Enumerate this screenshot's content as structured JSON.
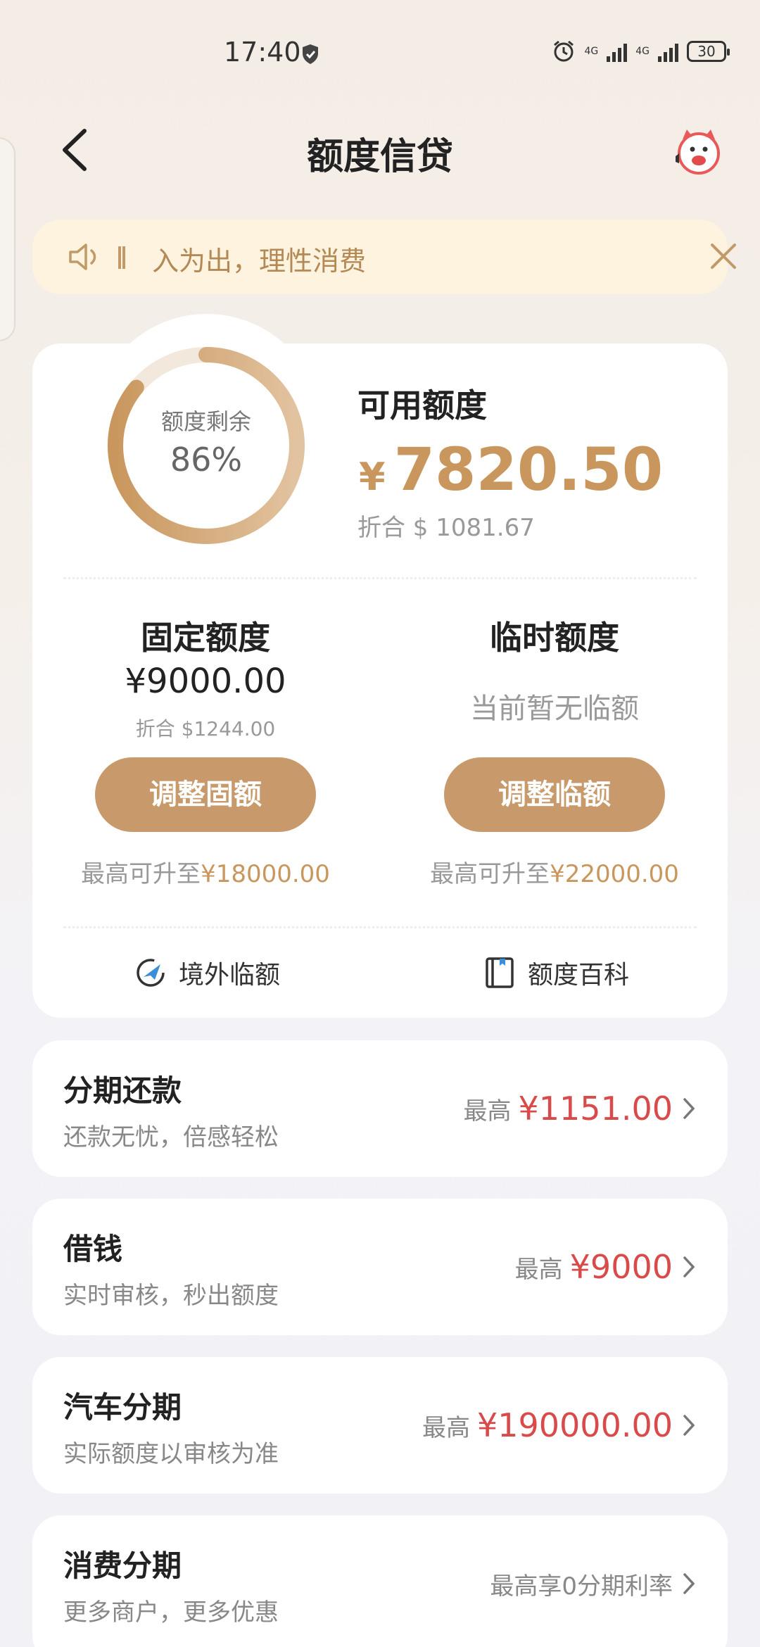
{
  "status_bar": {
    "time": "17:40",
    "signal1": "4G",
    "signal2": "4G",
    "battery": "30"
  },
  "header": {
    "title": "额度信贷"
  },
  "notice": {
    "text": "入为出，理性消费"
  },
  "quota": {
    "ring_label": "额度剩余",
    "ring_value": "86%",
    "ring_fraction": 0.86,
    "available_label": "可用额度",
    "currency_symbol": "¥",
    "available_amount": "7820.50",
    "available_usd": "折合 $ 1081.67",
    "fixed": {
      "title": "固定额度",
      "amount": "¥9000.00",
      "usd": "折合 $1244.00",
      "button": "调整固额",
      "max_prefix": "最高可升至",
      "max_value": "¥18000.00"
    },
    "temp": {
      "title": "临时额度",
      "none_text": "当前暂无临额",
      "button": "调整临额",
      "max_prefix": "最高可升至",
      "max_value": "¥22000.00"
    },
    "links": {
      "overseas": "境外临额",
      "encyclopedia": "额度百科"
    }
  },
  "list": [
    {
      "title": "分期还款",
      "subtitle": "还款无忧，倍感轻松",
      "prefix": "最高",
      "amount": "¥1151.00"
    },
    {
      "title": "借钱",
      "subtitle": "实时审核，秒出额度",
      "prefix": "最高",
      "amount": "¥9000"
    },
    {
      "title": "汽车分期",
      "subtitle": "实际额度以审核为准",
      "prefix": "最高",
      "amount": "¥190000.00"
    },
    {
      "title": "消费分期",
      "subtitle": "更多商户，更多优惠",
      "prefix": "最高享0分期利率",
      "amount": ""
    }
  ],
  "colors": {
    "accent_gold": "#c9975e",
    "button_gold": "#c8996a",
    "amount_red": "#d94b4b",
    "notice_bg": "#fdf3df"
  },
  "icons": {
    "back": "chevron-left-icon",
    "mascot": "mascot-avatar-icon",
    "speaker": "speaker-icon",
    "close": "close-icon",
    "plane": "plane-globe-icon",
    "book": "book-icon",
    "chevron": "chevron-right-icon"
  }
}
